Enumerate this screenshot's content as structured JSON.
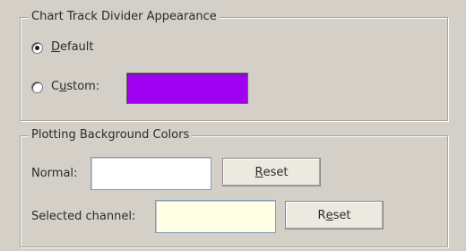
{
  "track_divider": {
    "title": "Chart Track Divider Appearance",
    "default_option": {
      "pre": "",
      "accel": "D",
      "post": "efault",
      "selected": true
    },
    "custom_option": {
      "pre": "C",
      "accel": "u",
      "post": "stom:",
      "selected": false
    },
    "custom_color": "#a000f0"
  },
  "plotting_background": {
    "title": "Plotting Background Colors",
    "normal_label": "Normal:",
    "normal_color": "#ffffff",
    "selected_label": "Selected channel:",
    "selected_color": "#ffffe6",
    "reset_normal": {
      "accel": "R",
      "post": "eset"
    },
    "reset_selected": {
      "pre": "R",
      "accel": "e",
      "post": "set"
    }
  }
}
